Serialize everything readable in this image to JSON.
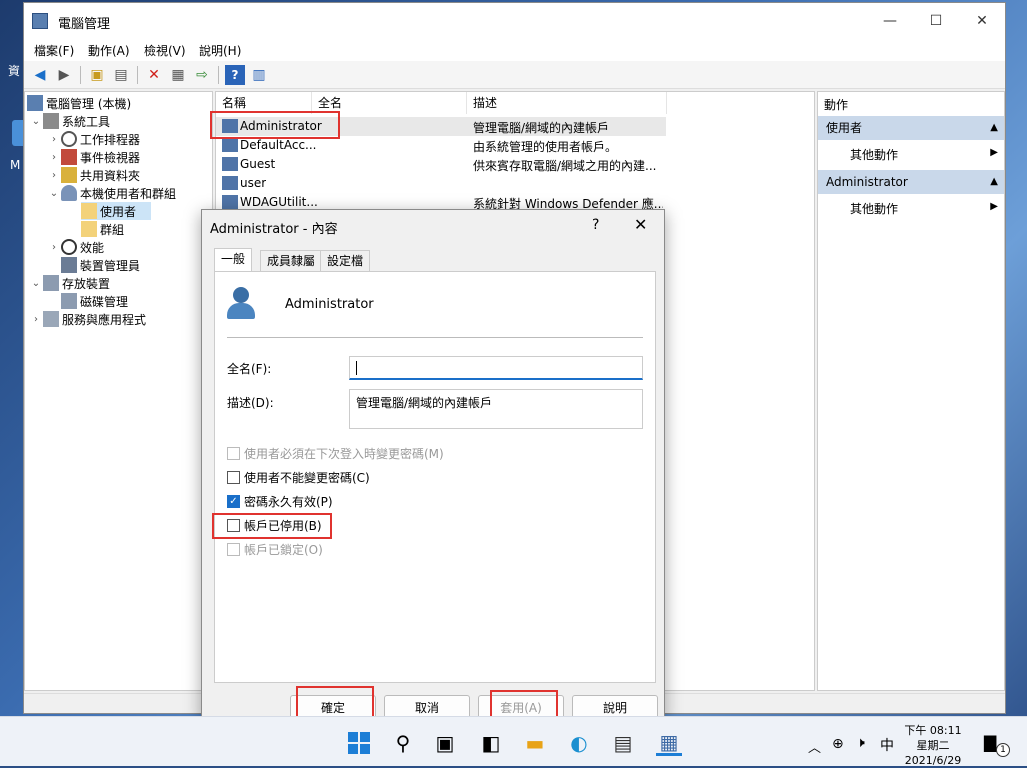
{
  "desktop": {
    "left_text": "資\nM"
  },
  "window": {
    "title": "電腦管理",
    "controls": {
      "minimize": "—",
      "maximize": "☐",
      "close": "✕"
    },
    "menu": [
      "檔案(F)",
      "動作(A)",
      "檢視(V)",
      "說明(H)"
    ]
  },
  "tree": {
    "items": [
      {
        "label": "電腦管理 (本機)",
        "indent": 0,
        "expander": ""
      },
      {
        "label": "系統工具",
        "indent": 1,
        "expander": "⌄"
      },
      {
        "label": "工作排程器",
        "indent": 2,
        "expander": "›"
      },
      {
        "label": "事件檢視器",
        "indent": 2,
        "expander": "›"
      },
      {
        "label": "共用資料夾",
        "indent": 2,
        "expander": "›"
      },
      {
        "label": "本機使用者和群組",
        "indent": 2,
        "expander": "⌄"
      },
      {
        "label": "使用者",
        "indent": 3,
        "expander": ""
      },
      {
        "label": "群組",
        "indent": 3,
        "expander": ""
      },
      {
        "label": "效能",
        "indent": 2,
        "expander": "›"
      },
      {
        "label": "裝置管理員",
        "indent": 2,
        "expander": ""
      },
      {
        "label": "存放裝置",
        "indent": 1,
        "expander": "⌄"
      },
      {
        "label": "磁碟管理",
        "indent": 2,
        "expander": ""
      },
      {
        "label": "服務與應用程式",
        "indent": 1,
        "expander": "›"
      }
    ]
  },
  "list": {
    "columns": [
      "名稱",
      "全名",
      "描述"
    ],
    "rows": [
      {
        "name": "Administrator",
        "fullname": "",
        "desc": "管理電腦/網域的內建帳戶"
      },
      {
        "name": "DefaultAcc...",
        "fullname": "",
        "desc": "由系統管理的使用者帳戶。"
      },
      {
        "name": "Guest",
        "fullname": "",
        "desc": "供來賓存取電腦/網域之用的內建..."
      },
      {
        "name": "user",
        "fullname": "",
        "desc": ""
      },
      {
        "name": "WDAGUtilit...",
        "fullname": "",
        "desc": "系統針對 Windows Defender 應..."
      }
    ]
  },
  "actions": {
    "header": "動作",
    "sections": [
      {
        "title": "使用者",
        "item": "其他動作"
      },
      {
        "title": "Administrator",
        "item": "其他動作"
      }
    ]
  },
  "dialog": {
    "title": "Administrator - 內容",
    "help": "?",
    "close": "✕",
    "tabs": [
      "一般",
      "成員隸屬",
      "設定檔"
    ],
    "username": "Administrator",
    "fullname_label": "全名(F):",
    "fullname_value": "",
    "desc_label": "描述(D):",
    "desc_value": "管理電腦/網域的內建帳戶",
    "checkboxes": [
      {
        "label": "使用者必須在下次登入時變更密碼(M)",
        "checked": false,
        "disabled": true
      },
      {
        "label": "使用者不能變更密碼(C)",
        "checked": false,
        "disabled": false
      },
      {
        "label": "密碼永久有效(P)",
        "checked": true,
        "disabled": false
      },
      {
        "label": "帳戶已停用(B)",
        "checked": false,
        "disabled": false
      },
      {
        "label": "帳戶已鎖定(O)",
        "checked": false,
        "disabled": true
      }
    ],
    "buttons": {
      "ok": "確定",
      "cancel": "取消",
      "apply": "套用(A)",
      "help": "說明"
    }
  },
  "taskbar": {
    "tray": {
      "chevron": "︿",
      "lang": "中",
      "time": "下午 08:11",
      "weekday": "星期二",
      "date": "2021/6/29",
      "notif_count": "1"
    }
  },
  "colors": {
    "highlight": "#e0332f",
    "accent": "#1a6fc9",
    "selection": "#cce4f7"
  }
}
